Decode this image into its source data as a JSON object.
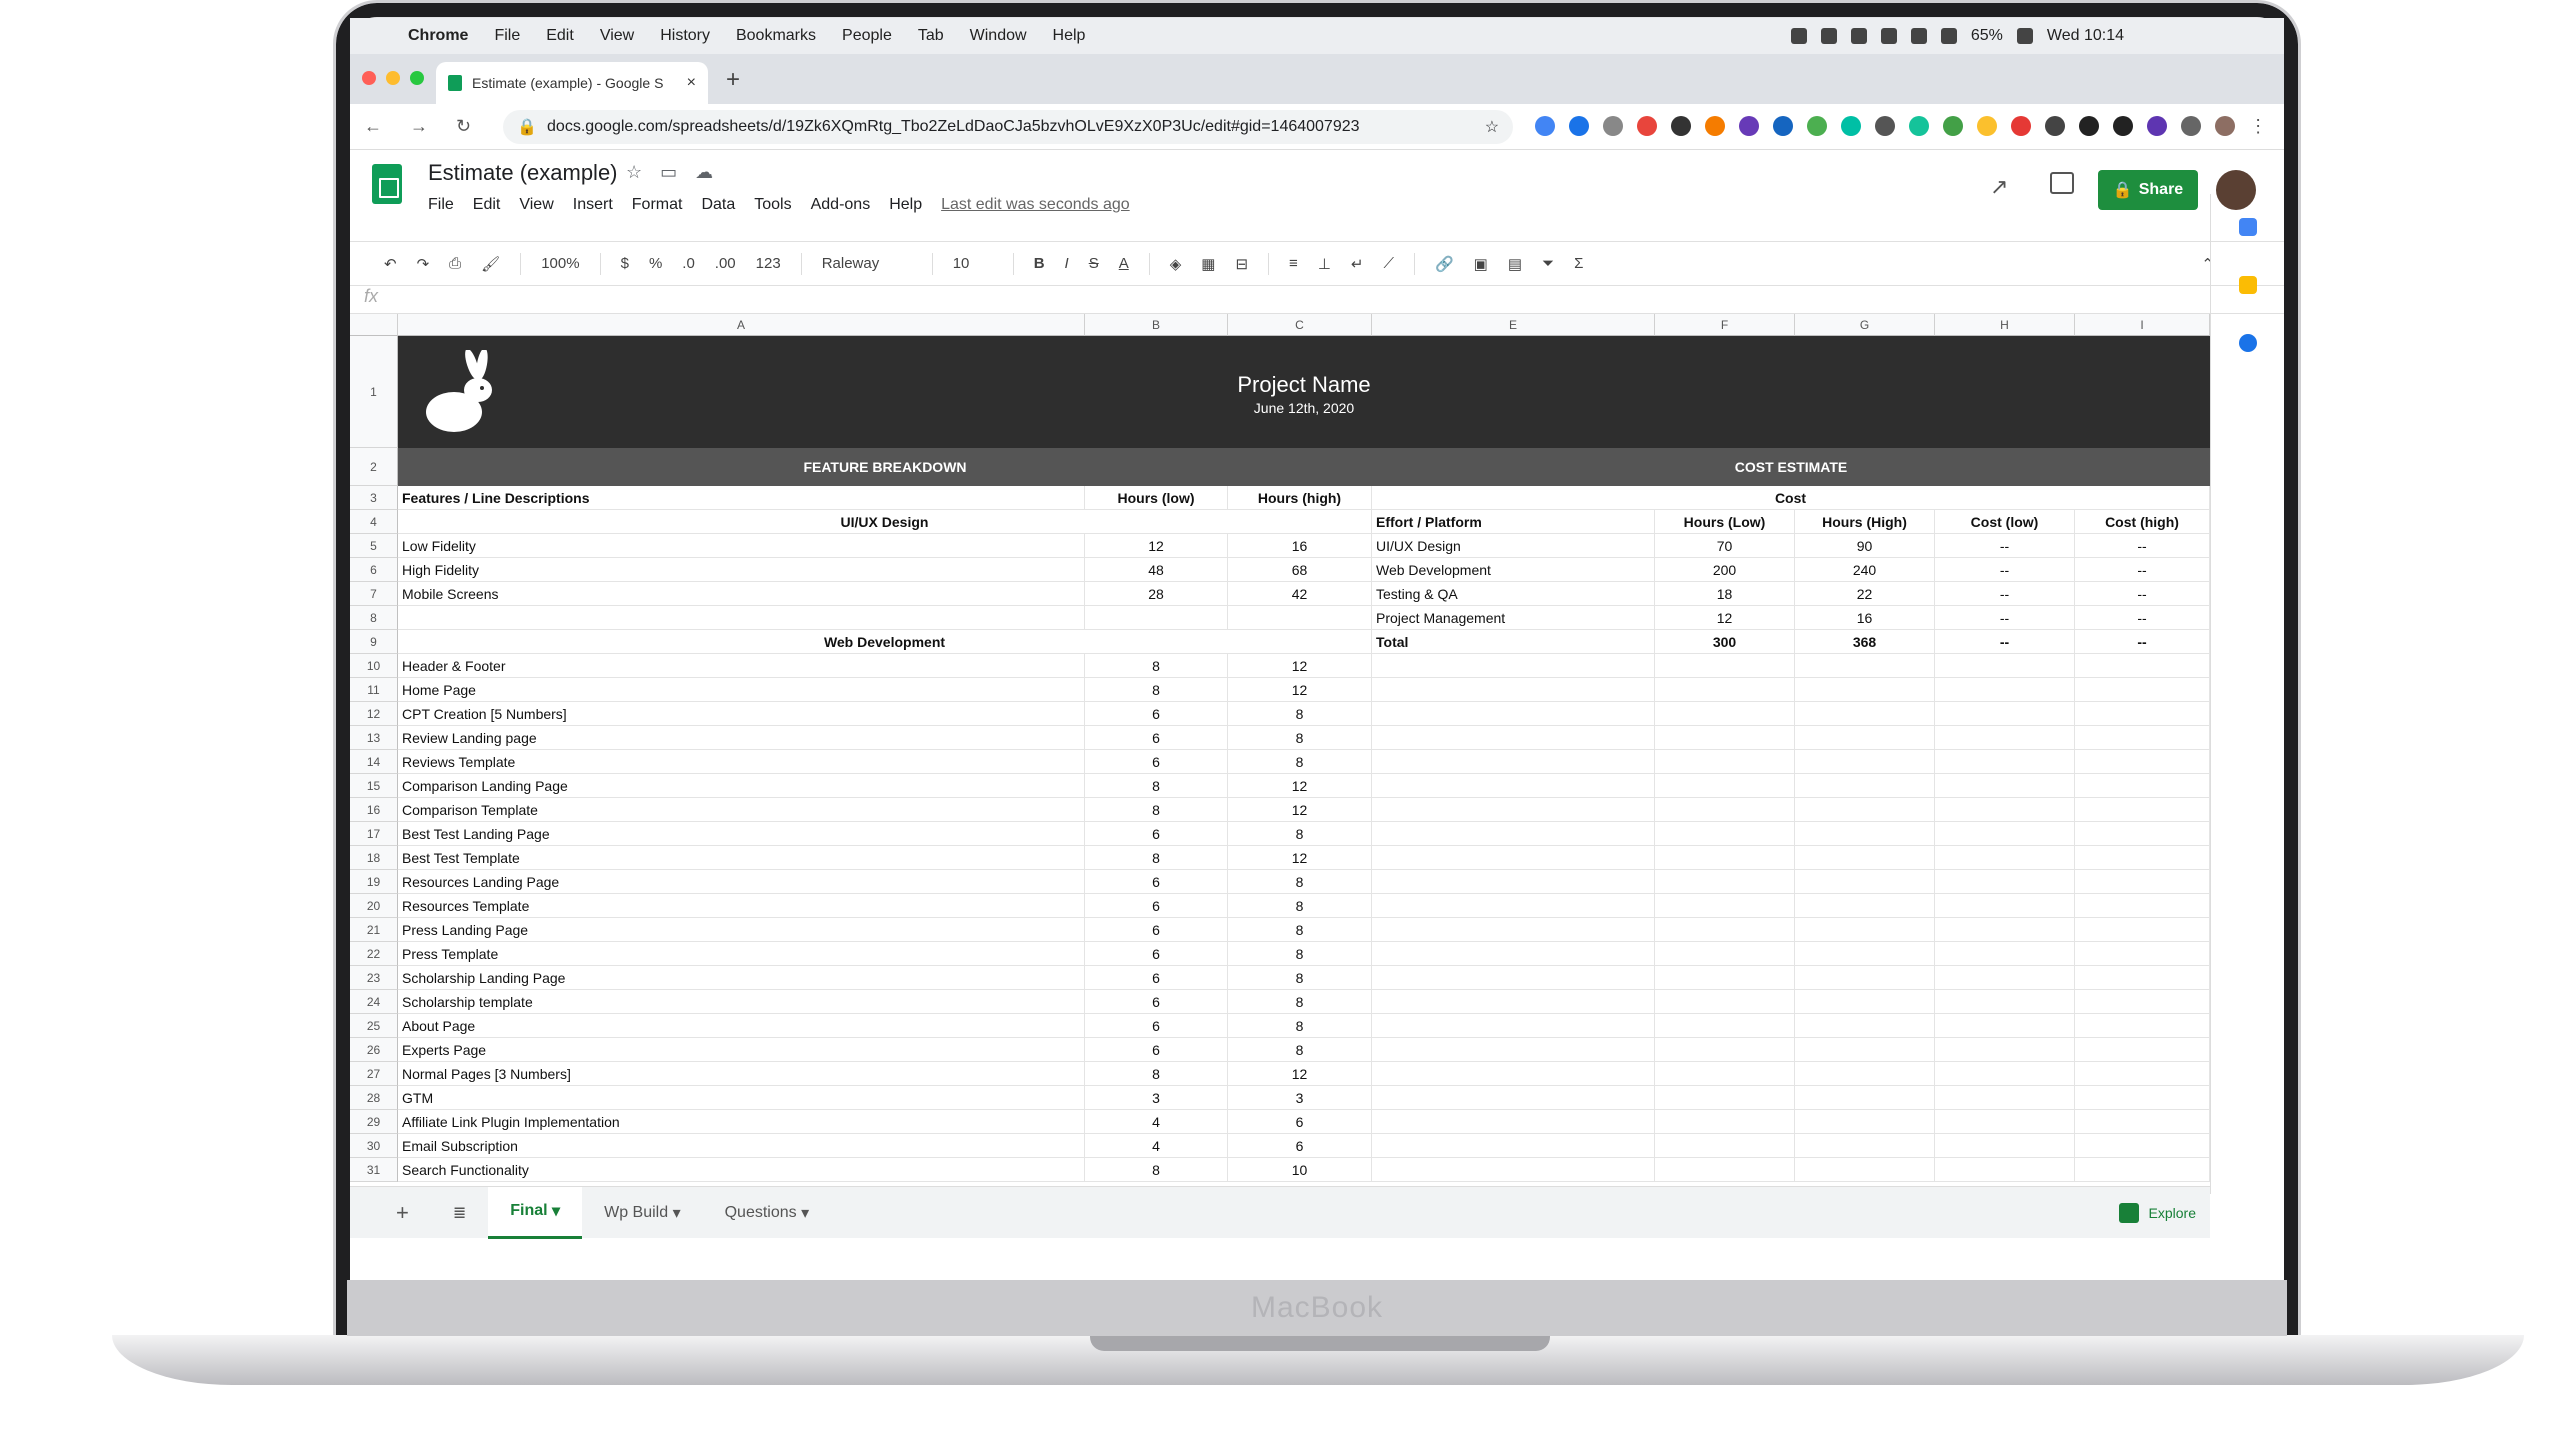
{
  "mac_menu": [
    "Chrome",
    "File",
    "Edit",
    "View",
    "History",
    "Bookmarks",
    "People",
    "Tab",
    "Window",
    "Help"
  ],
  "status": {
    "battery": "65%",
    "clock": "Wed 10:14"
  },
  "tab": {
    "title": "Estimate (example) - Google S"
  },
  "url": "docs.google.com/spreadsheets/d/19Zk6XQmRtg_Tbo2ZeLdDaoCJa5bzvhOLvE9XzX0P3Uc/edit#gid=1464007923",
  "doc": {
    "title": "Estimate (example)",
    "last_edit": "Last edit was seconds ago",
    "share": "Share"
  },
  "menus": [
    "File",
    "Edit",
    "View",
    "Insert",
    "Format",
    "Data",
    "Tools",
    "Add-ons",
    "Help"
  ],
  "toolbar": {
    "zoom": "100%",
    "currency": "$",
    "percent": "%",
    "dec1": ".0",
    "dec2": ".00",
    "fmt": "123",
    "font": "Raleway",
    "size": "10"
  },
  "formula_fx": "fx",
  "columns": [
    "A",
    "B",
    "C",
    "E",
    "F",
    "G",
    "H",
    "I"
  ],
  "rows": [
    "1",
    "2",
    "3",
    "4",
    "5",
    "6",
    "7",
    "8",
    "9",
    "10",
    "11",
    "12",
    "13",
    "14",
    "15",
    "16",
    "17",
    "18",
    "19",
    "20",
    "21",
    "22",
    "23",
    "24",
    "25",
    "26",
    "27",
    "28",
    "29",
    "30",
    "31"
  ],
  "banner": {
    "project": "Project Name",
    "date": "June 12th, 2020"
  },
  "sections": {
    "left": "FEATURE BREAKDOWN",
    "right": "COST ESTIMATE"
  },
  "left_header": {
    "desc": "Features / Line Descriptions",
    "low": "Hours (low)",
    "high": "Hours (high)"
  },
  "groups": {
    "ux": "UI/UX Design",
    "web": "Web Development"
  },
  "features": [
    {
      "name": "Low Fidelity",
      "low": "12",
      "high": "16"
    },
    {
      "name": "High Fidelity",
      "low": "48",
      "high": "68"
    },
    {
      "name": "Mobile Screens",
      "low": "28",
      "high": "42"
    },
    {
      "name": "",
      "low": "",
      "high": ""
    },
    {
      "name": "",
      "low": "",
      "high": ""
    },
    {
      "name": "Header & Footer",
      "low": "8",
      "high": "12"
    },
    {
      "name": "Home Page",
      "low": "8",
      "high": "12"
    },
    {
      "name": "CPT Creation [5 Numbers]",
      "low": "6",
      "high": "8"
    },
    {
      "name": "Review Landing page",
      "low": "6",
      "high": "8"
    },
    {
      "name": "Reviews Template",
      "low": "6",
      "high": "8"
    },
    {
      "name": "Comparison Landing Page",
      "low": "8",
      "high": "12"
    },
    {
      "name": "Comparison Template",
      "low": "8",
      "high": "12"
    },
    {
      "name": "Best Test Landing Page",
      "low": "6",
      "high": "8"
    },
    {
      "name": "Best Test Template",
      "low": "8",
      "high": "12"
    },
    {
      "name": "Resources Landing Page",
      "low": "6",
      "high": "8"
    },
    {
      "name": "Resources Template",
      "low": "6",
      "high": "8"
    },
    {
      "name": "Press Landing Page",
      "low": "6",
      "high": "8"
    },
    {
      "name": "Press Template",
      "low": "6",
      "high": "8"
    },
    {
      "name": "Scholarship Landing Page",
      "low": "6",
      "high": "8"
    },
    {
      "name": "Scholarship template",
      "low": "6",
      "high": "8"
    },
    {
      "name": "About Page",
      "low": "6",
      "high": "8"
    },
    {
      "name": "Experts Page",
      "low": "6",
      "high": "8"
    },
    {
      "name": "Normal Pages [3 Numbers]",
      "low": "8",
      "high": "12"
    },
    {
      "name": "GTM",
      "low": "3",
      "high": "3"
    },
    {
      "name": "Affiliate Link Plugin Implementation",
      "low": "4",
      "high": "6"
    },
    {
      "name": "Email Subscription",
      "low": "4",
      "high": "6"
    },
    {
      "name": "Search Functionality",
      "low": "8",
      "high": "10"
    }
  ],
  "cost": {
    "title": "Cost",
    "headers": [
      "Effort / Platform",
      "Hours (Low)",
      "Hours (High)",
      "Cost (low)",
      "Cost (high)"
    ],
    "rows": [
      [
        "UI/UX Design",
        "70",
        "90",
        "--",
        "--"
      ],
      [
        "Web Development",
        "200",
        "240",
        "--",
        "--"
      ],
      [
        "Testing & QA",
        "18",
        "22",
        "--",
        "--"
      ],
      [
        "Project Management",
        "12",
        "16",
        "--",
        "--"
      ],
      [
        "Total",
        "300",
        "368",
        "--",
        "--"
      ]
    ]
  },
  "sheets": [
    "Final",
    "Wp Build",
    "Questions"
  ],
  "explore": "Explore",
  "laptop_brand": "MacBook"
}
